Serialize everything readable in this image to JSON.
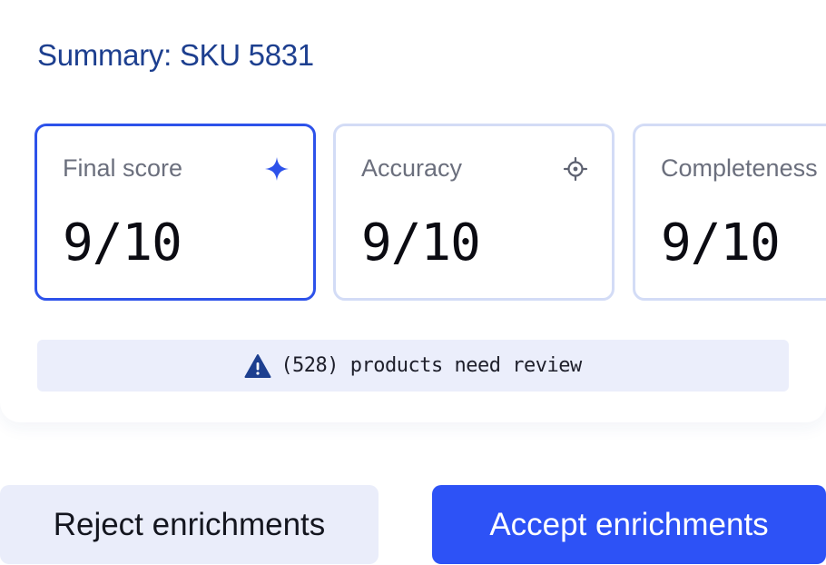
{
  "summary": {
    "title": "Summary: SKU 5831"
  },
  "cards": [
    {
      "label": "Final score",
      "value": "9/10",
      "icon": "sparkle-icon",
      "active": true
    },
    {
      "label": "Accuracy",
      "value": "9/10",
      "icon": "crosshair-icon",
      "active": false
    },
    {
      "label": "Completeness",
      "value": "9/10",
      "icon": "",
      "active": false
    }
  ],
  "notice": {
    "text": "(528) products need review",
    "icon": "warning-icon"
  },
  "actions": {
    "reject_label": "Reject enrichments",
    "accept_label": "Accept enrichments"
  },
  "colors": {
    "title": "#1d3f8f",
    "active_border": "#2d52ea",
    "inactive_border": "#d3dcf6",
    "notice_bg": "#ebeefb",
    "accept_bg": "#2d52f6",
    "reject_bg": "#eaedfa",
    "warning_icon": "#1d3f8f"
  }
}
